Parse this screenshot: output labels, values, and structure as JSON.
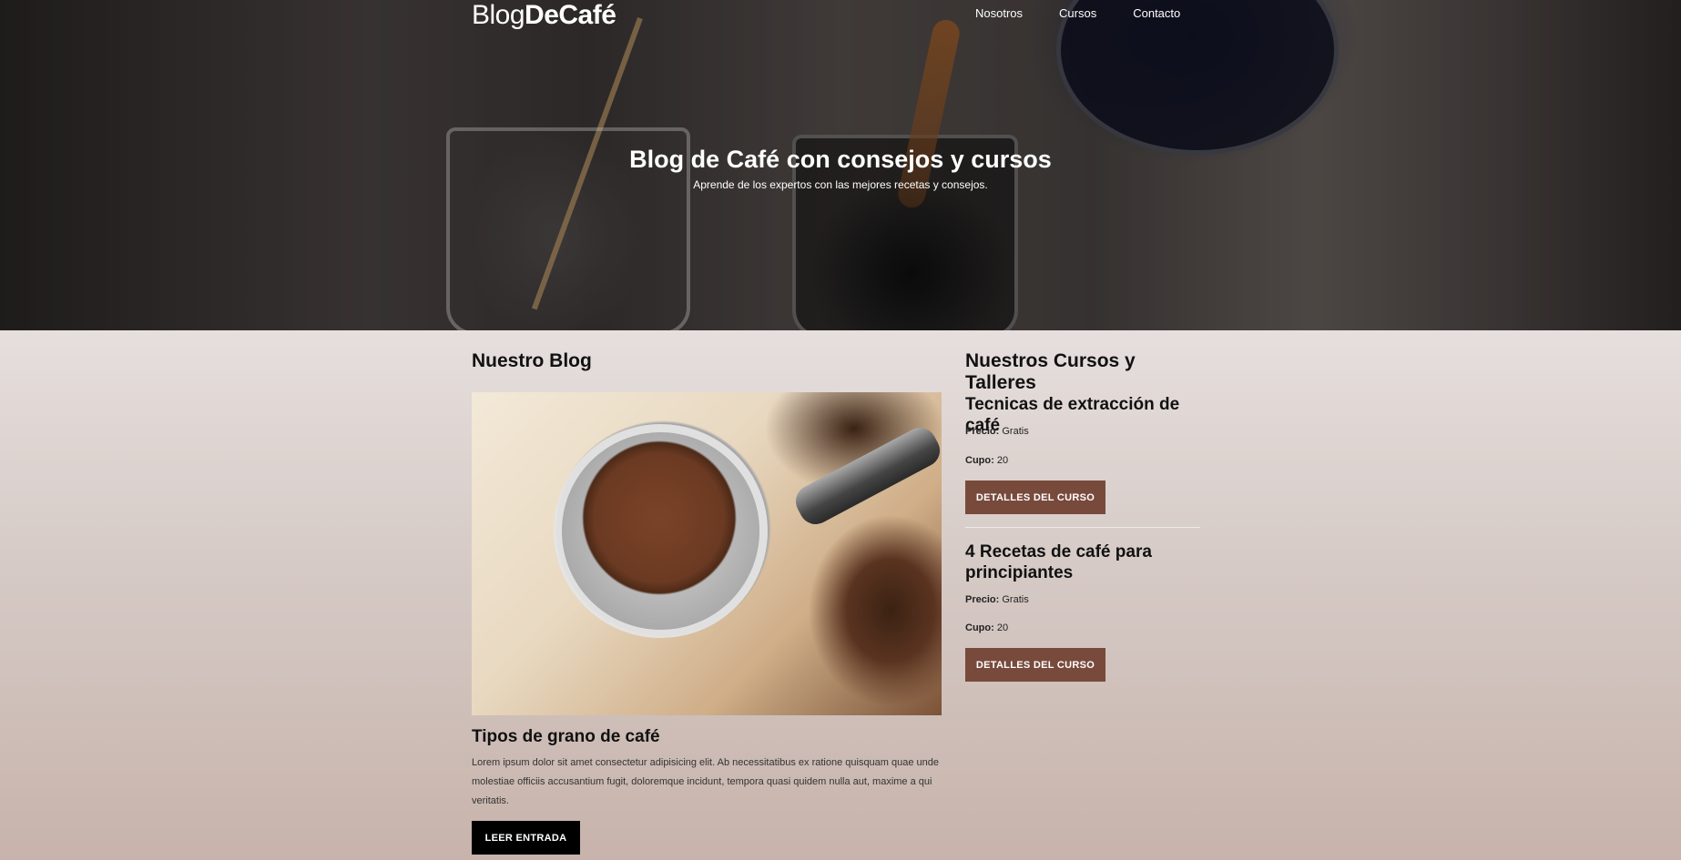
{
  "header": {
    "logo_light": "Blog",
    "logo_bold": "DeCafé",
    "nav": [
      "Nosotros",
      "Cursos",
      "Contacto"
    ]
  },
  "hero": {
    "title": "Blog de Café con consejos y cursos",
    "subtitle": "Aprende de los expertos con las mejores recetas y consejos."
  },
  "blog": {
    "section_title": "Nuestro Blog",
    "post": {
      "title": "Tipos de grano de café",
      "excerpt": "Lorem ipsum dolor sit amet consectetur adipisicing elit. Ab necessitatibus ex ratione quisquam quae unde molestiae officiis accusantium fugit, doloremque incidunt, tempora quasi quidem nulla aut, maxime a qui veritatis.",
      "button": "LEER ENTRADA"
    }
  },
  "courses": {
    "section_title": "Nuestros Cursos y Talleres",
    "price_label": "Precio:",
    "spots_label": "Cupo:",
    "button": "DETALLES DEL CURSO",
    "items": [
      {
        "title": "Tecnicas de extracción de café",
        "price": "Gratis",
        "spots": "20"
      },
      {
        "title": "4 Recetas de café para principiantes",
        "price": "Gratis",
        "spots": "20"
      }
    ]
  },
  "colors": {
    "accent_brown": "#784a3c",
    "dark_button": "#000000"
  }
}
